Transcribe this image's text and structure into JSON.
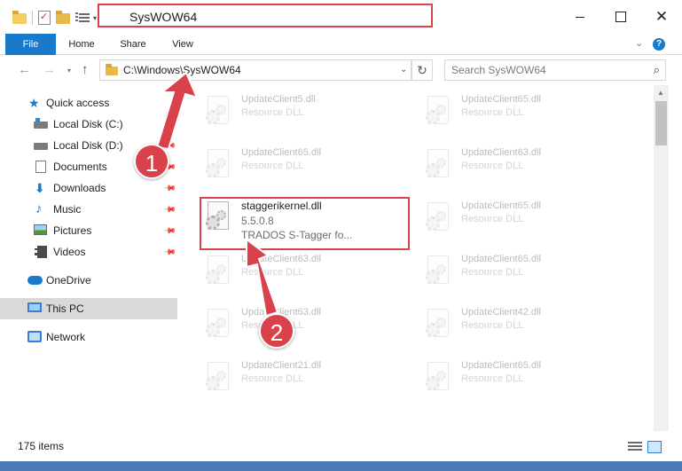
{
  "window": {
    "title": "SysWOW64",
    "close_glyph": "✕"
  },
  "ribbon": {
    "tabs": [
      "File",
      "Home",
      "Share",
      "View"
    ],
    "help_glyph": "?",
    "expand_glyph": "⌄"
  },
  "nav": {
    "back_glyph": "←",
    "forward_glyph": "→",
    "dropdown_glyph": "▾",
    "up_glyph": "↑",
    "address": "C:\\Windows\\SysWOW64",
    "address_dropdown_glyph": "⌄",
    "refresh_glyph": "↻",
    "search_placeholder": "Search SysWOW64",
    "search_glyph": "⌕"
  },
  "sidebar": {
    "items": [
      {
        "label": "Quick access",
        "icon": "star-icon"
      },
      {
        "label": "Local Disk (C:)",
        "icon": "drive-icon",
        "pinned": true
      },
      {
        "label": "Local Disk (D:)",
        "icon": "drive-icon",
        "pinned": true
      },
      {
        "label": "Documents",
        "icon": "documents-icon",
        "pinned": true
      },
      {
        "label": "Downloads",
        "icon": "downloads-icon",
        "pinned": true
      },
      {
        "label": "Music",
        "icon": "music-icon",
        "pinned": true
      },
      {
        "label": "Pictures",
        "icon": "pictures-icon",
        "pinned": true
      },
      {
        "label": "Videos",
        "icon": "videos-icon",
        "pinned": true
      },
      {
        "label": "OneDrive",
        "icon": "onedrive-icon"
      },
      {
        "label": "This PC",
        "icon": "this-pc-icon",
        "selected": true
      },
      {
        "label": "Network",
        "icon": "network-icon"
      }
    ],
    "pin_glyph": "📌"
  },
  "files": [
    {
      "name": "UpdateClient5.dll",
      "type": "Resource DLL",
      "faded": true
    },
    {
      "name": "UpdateClient65.dll",
      "type": "Resource DLL",
      "faded": true
    },
    {
      "name": "UpdateClient65.dll",
      "type": "Resource DLL",
      "faded": true
    },
    {
      "name": "UpdateClient63.dll",
      "type": "Resource DLL",
      "faded": true
    },
    {
      "name": "staggerikernel.dll",
      "version": "5.5.0.8",
      "description": "TRADOS S-Tagger  fo...",
      "faded": false
    },
    {
      "name": "UpdateClient65.dll",
      "type": "Resource DLL",
      "faded": true
    },
    {
      "name": "UpdateClient63.dll",
      "type": "Resource DLL",
      "faded": true
    },
    {
      "name": "UpdateClient65.dll",
      "type": "Resource DLL",
      "faded": true
    },
    {
      "name": "UpdateClient63.dll",
      "type": "Resource DLL",
      "faded": true
    },
    {
      "name": "UpdateClient42.dll",
      "type": "Resource DLL",
      "faded": true
    },
    {
      "name": "UpdateClient21.dll",
      "type": "Resource DLL",
      "faded": true
    },
    {
      "name": "UpdateClient65.dll",
      "type": "Resource DLL",
      "faded": true
    }
  ],
  "status": {
    "item_count": "175 items"
  },
  "callouts": [
    "1",
    "2"
  ],
  "colors": {
    "accent": "#1979ca",
    "highlight_red": "#d9414b"
  }
}
